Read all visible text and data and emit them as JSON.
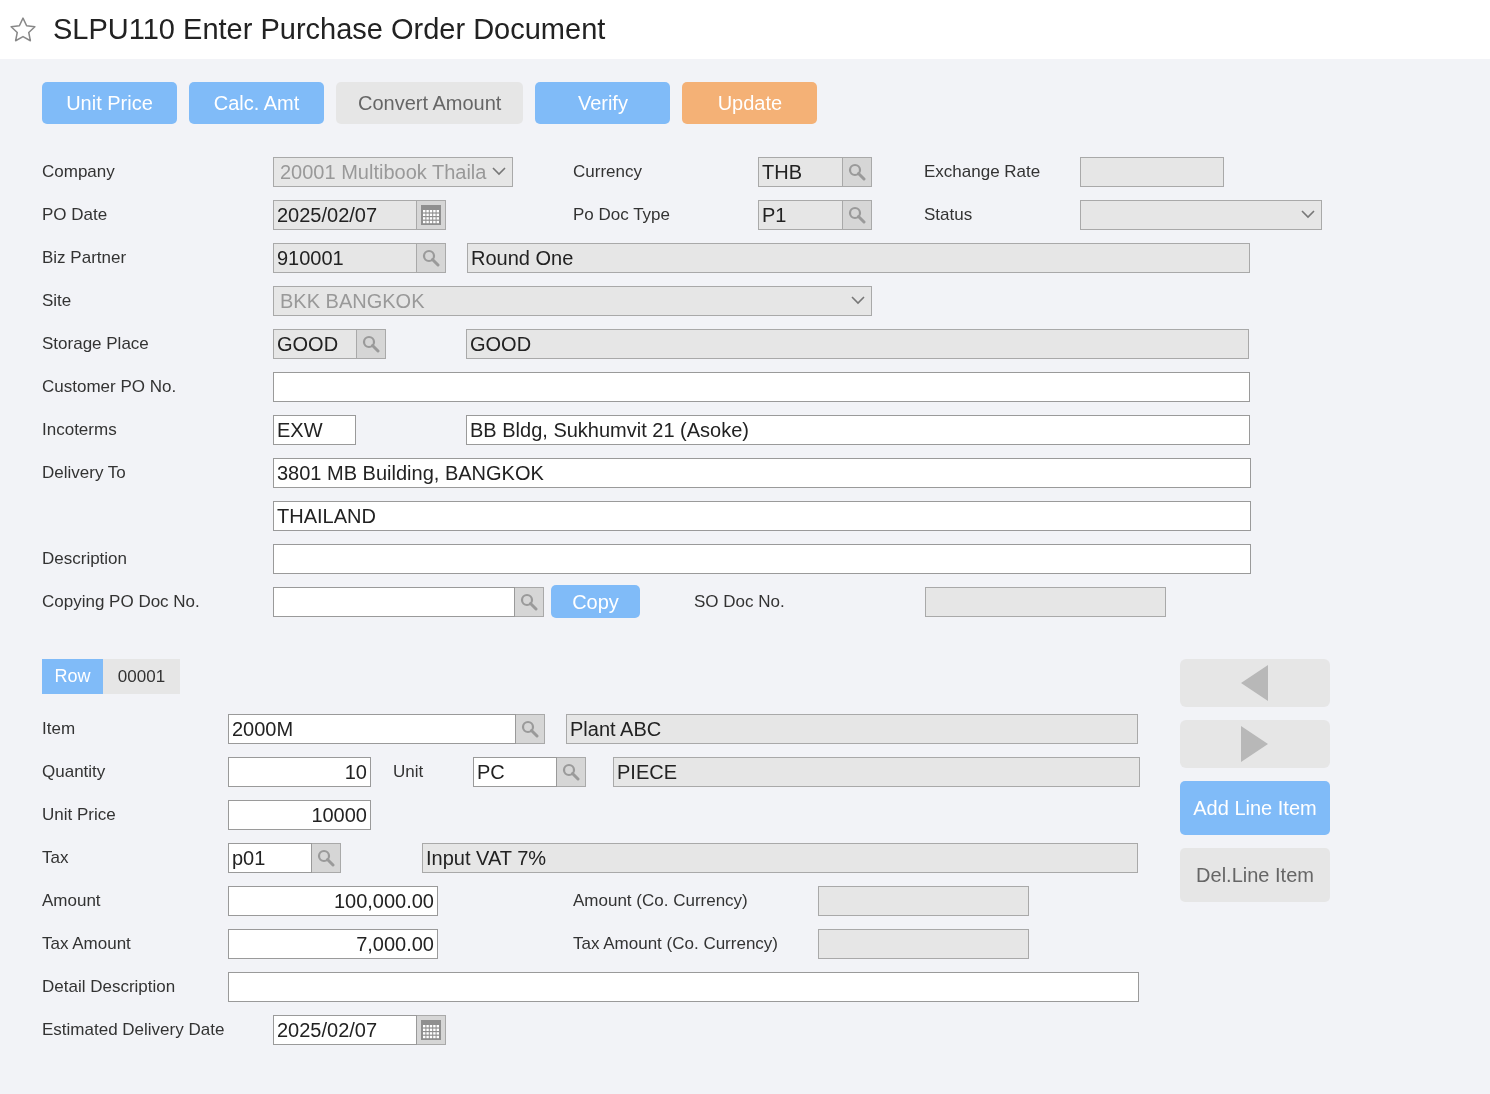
{
  "title": "SLPU110 Enter Purchase Order Document",
  "favorite": false,
  "toolbar": [
    {
      "label": "Unit Price",
      "kind": "primary"
    },
    {
      "label": "Calc. Amt",
      "kind": "primary"
    },
    {
      "label": "Convert Amount",
      "kind": "disabled"
    },
    {
      "label": "Verify",
      "kind": "primary"
    },
    {
      "label": "Update",
      "kind": "accent"
    }
  ],
  "header": {
    "company": {
      "label": "Company",
      "field": {
        "kind": "select",
        "value": "20001 Multibook Thaila",
        "disabled": true
      }
    },
    "currency": {
      "label": "Currency",
      "field": {
        "kind": "lookup",
        "value": "THB",
        "disabled": true
      }
    },
    "exchange_rate": {
      "label": "Exchange Rate",
      "field": {
        "kind": "text",
        "disabled": true
      }
    },
    "po_date": {
      "label": "PO Date",
      "field": {
        "kind": "date",
        "value": "2025/02/07",
        "disabled": true
      }
    },
    "po_doc_type": {
      "label": "Po Doc Type",
      "field": {
        "kind": "lookup",
        "value": "P1",
        "disabled": true
      }
    },
    "status": {
      "label": "Status",
      "field": {
        "kind": "select",
        "disabled": true
      }
    },
    "biz_partner": {
      "label": "Biz Partner",
      "field": {
        "kind": "lookup",
        "value": "910001",
        "disabled": true
      },
      "name": {
        "kind": "text",
        "value": "Round One",
        "disabled": true
      }
    },
    "site": {
      "label": "Site",
      "field": {
        "kind": "select",
        "value": "BKK BANGKOK",
        "disabled": true
      }
    },
    "storage_place": {
      "label": "Storage Place",
      "field": {
        "kind": "lookup",
        "value": "GOOD",
        "disabled": true
      },
      "name": {
        "kind": "text",
        "value": "GOOD",
        "disabled": true
      }
    },
    "customer_po_no": {
      "label": "Customer PO No.",
      "field": {
        "kind": "text",
        "disabled": false
      }
    },
    "incoterms": {
      "label": "Incoterms",
      "field": {
        "kind": "text",
        "value": "EXW",
        "disabled": false
      },
      "name": {
        "kind": "text",
        "value": "BB Bldg, Sukhumvit 21 (Asoke)",
        "disabled": false
      }
    },
    "delivery_to": {
      "label": "Delivery To",
      "lines": [
        {
          "kind": "text",
          "value": "3801 MB Building, BANGKOK",
          "disabled": false
        },
        {
          "kind": "text",
          "value": "THAILAND",
          "disabled": false
        }
      ]
    },
    "description": {
      "label": "Description",
      "field": {
        "kind": "text",
        "disabled": false
      }
    },
    "copying_po_doc_no": {
      "label": "Copying PO Doc No.",
      "field": {
        "kind": "lookup",
        "disabled": false
      },
      "button": {
        "label": "Copy",
        "kind": "primary"
      }
    },
    "so_doc_no": {
      "label": "SO Doc No.",
      "field": {
        "kind": "text",
        "disabled": true
      }
    }
  },
  "line": {
    "tab": {
      "label": "Row",
      "selected": true
    },
    "row_no": "00001",
    "item": {
      "label": "Item",
      "field": {
        "kind": "lookup",
        "value": "2000M",
        "disabled": false
      },
      "name": {
        "kind": "text",
        "value": "Plant ABC",
        "disabled": true
      }
    },
    "quantity": {
      "label": "Quantity",
      "field": {
        "kind": "number",
        "value": "10",
        "disabled": false
      }
    },
    "unit": {
      "label": "Unit",
      "field": {
        "kind": "lookup",
        "value": "PC",
        "disabled": false
      },
      "name": {
        "kind": "text",
        "value": "PIECE",
        "disabled": true
      }
    },
    "unit_price": {
      "label": "Unit Price",
      "field": {
        "kind": "number",
        "value": "10000",
        "disabled": false
      }
    },
    "tax": {
      "label": "Tax",
      "field": {
        "kind": "lookup",
        "value": "p01",
        "disabled": false
      },
      "name": {
        "kind": "text",
        "value": "Input VAT 7%",
        "disabled": true
      }
    },
    "amount": {
      "label": "Amount",
      "field": {
        "kind": "number",
        "value": "100,000.00",
        "disabled": false
      }
    },
    "amount_co": {
      "label": "Amount (Co. Currency)",
      "field": {
        "kind": "text",
        "disabled": true
      }
    },
    "tax_amount": {
      "label": "Tax Amount",
      "field": {
        "kind": "number",
        "value": "7,000.00",
        "disabled": false
      }
    },
    "tax_amount_co": {
      "label": "Tax Amount (Co. Currency)",
      "field": {
        "kind": "text",
        "disabled": true
      }
    },
    "detail_description": {
      "label": "Detail Description",
      "field": {
        "kind": "text",
        "disabled": false
      }
    },
    "estimated_delivery_date": {
      "label": "Estimated Delivery Date",
      "field": {
        "kind": "date",
        "value": "2025/02/07",
        "disabled": false
      }
    },
    "navigation": [
      {
        "kind": "previous"
      },
      {
        "kind": "next"
      }
    ],
    "actions": [
      {
        "label": "Add Line Item",
        "kind": "primary"
      },
      {
        "label": "Del.Line Item",
        "kind": "disabled"
      }
    ]
  }
}
